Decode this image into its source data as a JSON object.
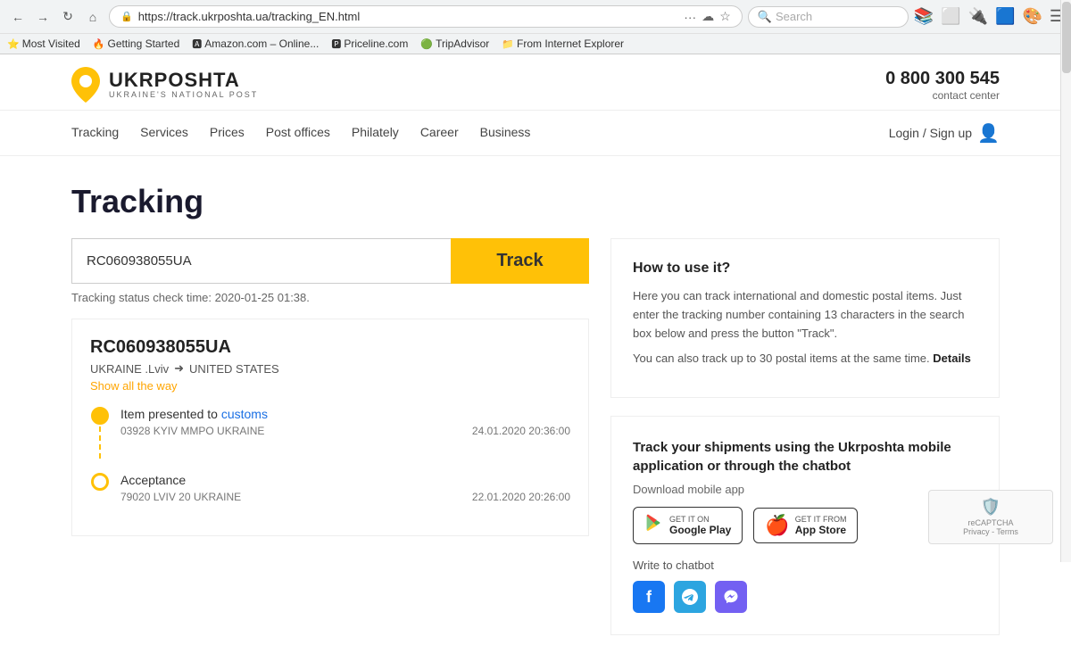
{
  "browser": {
    "url": "https://track.ukrposhta.ua/tracking_EN.html",
    "search_placeholder": "Search",
    "bookmarks": [
      {
        "label": "Most Visited",
        "icon": "⭐"
      },
      {
        "label": "Getting Started",
        "icon": "🔥"
      },
      {
        "label": "Amazon.com – Online...",
        "icon": "🅰"
      },
      {
        "label": "Priceline.com",
        "icon": "🅿"
      },
      {
        "label": "TripAdvisor",
        "icon": "🟢"
      },
      {
        "label": "From Internet Explorer",
        "icon": "📁"
      }
    ]
  },
  "header": {
    "logo_name": "UKRPOSHTA",
    "logo_tagline": "UKRAINE'S NATIONAL POST",
    "phone": "0 800 300 545",
    "contact_label": "contact center"
  },
  "nav": {
    "links": [
      "Tracking",
      "Services",
      "Prices",
      "Post offices",
      "Philately",
      "Career",
      "Business"
    ],
    "login_label": "Login / Sign up"
  },
  "page": {
    "title": "Tracking"
  },
  "tracking": {
    "input_value": "RC060938055UA",
    "track_button": "Track",
    "status_time": "Tracking status check time: 2020-01-25 01:38.",
    "result": {
      "number": "RC060938055UA",
      "from_city": "UKRAINE .Lviv",
      "to_city": "UNITED STATES",
      "show_way_label": "Show all the way",
      "events": [
        {
          "label": "Item presented to customs",
          "highlight": "customs",
          "location": "03928 KYIV MMPO UKRAINE",
          "date": "24.01.2020 20:36:00",
          "dot_filled": true
        },
        {
          "label": "Acceptance",
          "highlight": "",
          "location": "79020 LVIV 20 UKRAINE",
          "date": "22.01.2020 20:26:00",
          "dot_filled": false
        }
      ]
    }
  },
  "info_card": {
    "title": "How to use it?",
    "text1": "Here you can track international and domestic postal items. Just enter the tracking number containing 13 characters in the search box below and press the button \"Track\".",
    "text2": "You can also track up to 30 postal items at the same time.",
    "details_label": "Details"
  },
  "app_card": {
    "title": "Track your shipments using the Ukrposhta mobile application or through the chatbot",
    "subtitle": "Download mobile app",
    "google_play_sub": "GET IT ON",
    "google_play_label": "Google Play",
    "app_store_sub": "GET IT FROM",
    "app_store_label": "App Store",
    "chatbot_label": "Write to chatbot",
    "social": [
      {
        "name": "facebook",
        "symbol": "f",
        "class": "fb"
      },
      {
        "name": "telegram",
        "symbol": "✈",
        "class": "tg"
      },
      {
        "name": "viber",
        "symbol": "📞",
        "class": "vb"
      }
    ]
  },
  "recaptcha": {
    "label": "reCAPTCHA",
    "sub": "Privacy - Terms"
  }
}
